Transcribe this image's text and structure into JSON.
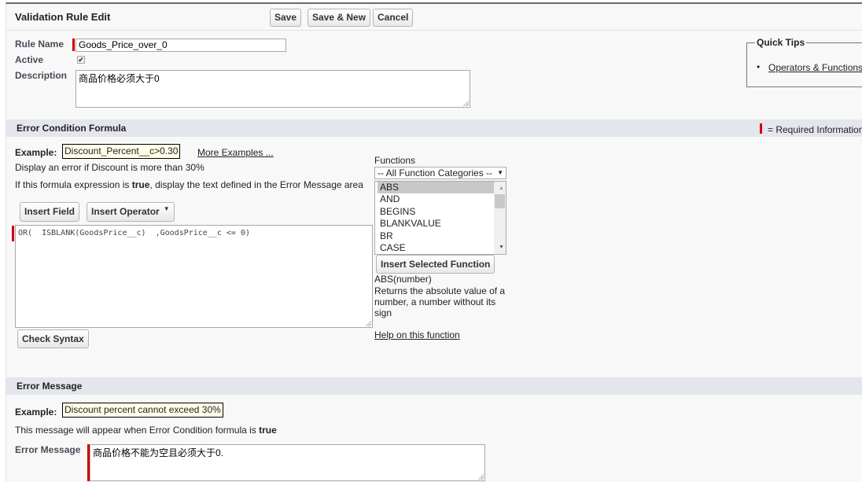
{
  "header": {
    "title": "Validation Rule Edit",
    "save": "Save",
    "save_new": "Save & New",
    "cancel": "Cancel"
  },
  "rule": {
    "name_label": "Rule Name",
    "name_value": "Goods_Price_over_0",
    "active_label": "Active",
    "active_checked": true,
    "description_label": "Description",
    "description_value": "商品价格必须大于0"
  },
  "quick_tips": {
    "title": "Quick Tips",
    "link": "Operators & Functions"
  },
  "formula_section": {
    "title": "Error Condition Formula",
    "required_legend": "= Required Information",
    "example_label": "Example:",
    "example_value": "Discount_Percent__c>0.30",
    "more_examples": "More Examples ...",
    "example_desc": "Display an error if Discount is more than 30%",
    "hint_pre": "If this formula expression is ",
    "hint_bold": "true",
    "hint_post": ", display the text defined in the Error Message area",
    "insert_field": "Insert Field",
    "insert_operator": "Insert Operator",
    "formula_value": "OR(  ISBLANK(GoodsPrice__c)  ,GoodsPrice__c <= 0)",
    "check_syntax": "Check Syntax"
  },
  "functions": {
    "label": "Functions",
    "category_selected": "-- All Function Categories --",
    "items": [
      "ABS",
      "AND",
      "BEGINS",
      "BLANKVALUE",
      "BR",
      "CASE"
    ],
    "selected": "ABS",
    "insert_selected": "Insert Selected Function",
    "signature": "ABS(number)",
    "description": "Returns the absolute value of a number, a number without its sign",
    "help_link": "Help on this function"
  },
  "error_section": {
    "title": "Error Message",
    "example_label": "Example:",
    "example_value": "Discount percent cannot exceed 30%",
    "hint_pre": "This message will appear when Error Condition formula is ",
    "hint_bold": "true",
    "message_label": "Error Message",
    "message_value": "商品价格不能为空且必须大于0."
  },
  "colors": {
    "required": "#cc0000",
    "section_bg": "#e3e6ed",
    "selected_item": "#c8c8c8"
  }
}
